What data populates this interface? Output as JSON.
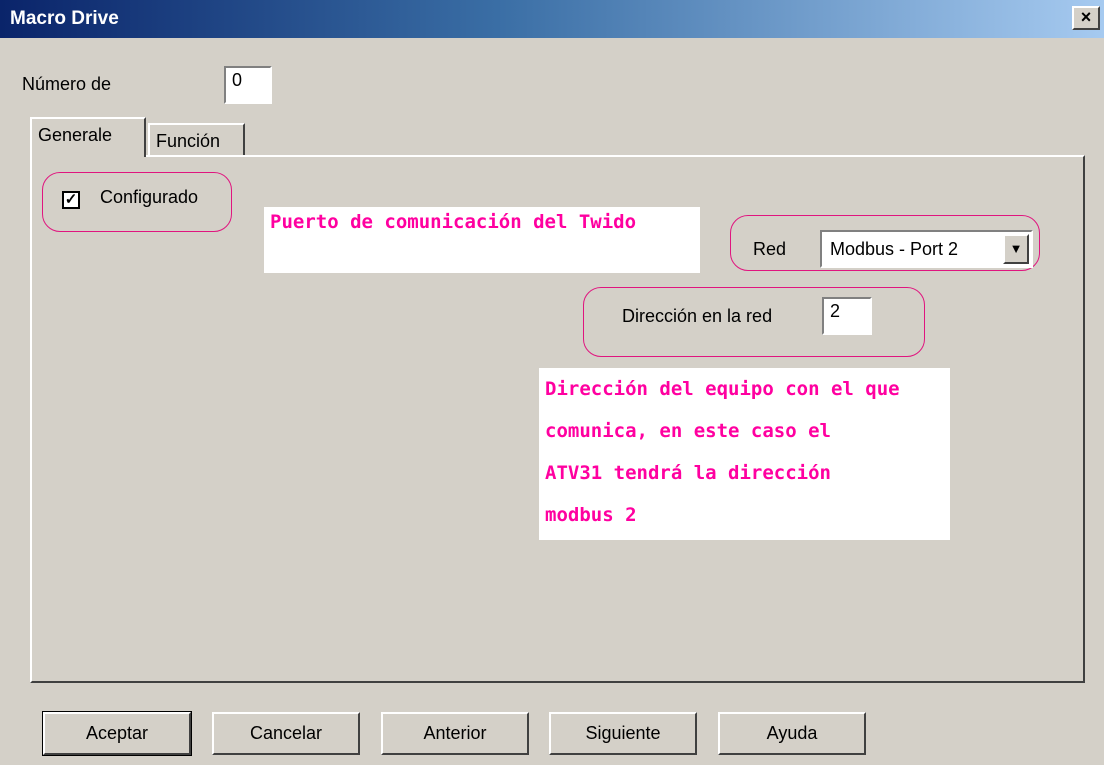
{
  "window": {
    "title": "Macro Drive",
    "close_label": "×"
  },
  "form": {
    "numero_label": "Número de",
    "numero_value": "0"
  },
  "tabs": [
    {
      "label": "Generale"
    },
    {
      "label": "Función"
    }
  ],
  "generale": {
    "configurado_label": "Configurado",
    "configurado_checked": true,
    "red_label": "Red",
    "red_value": "Modbus - Port 2",
    "direccion_label": "Dirección en la red",
    "direccion_value": "2"
  },
  "annotations": {
    "puerto": "Puerto de comunicación del Twido",
    "direccion_lines": [
      "Dirección del equipo con el que",
      "comunica, en este caso el",
      "ATV31 tendrá la dirección",
      "modbus 2"
    ],
    "color": "#ff00a0"
  },
  "buttons": {
    "aceptar": "Aceptar",
    "cancelar": "Cancelar",
    "anterior": "Anterior",
    "siguiente": "Siguiente",
    "ayuda": "Ayuda"
  }
}
